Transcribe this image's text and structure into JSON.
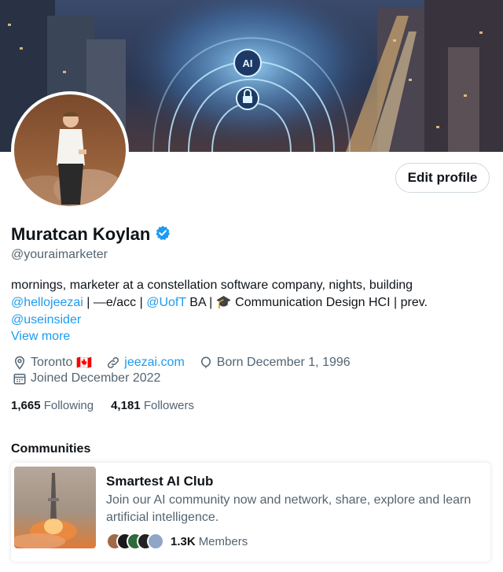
{
  "profile": {
    "name": "Muratcan Koylan",
    "handle": "@youraimarketer",
    "edit_button": "Edit profile",
    "verified_icon": "verified-badge-icon",
    "bio": {
      "line1": "mornings, marketer at a constellation software company, nights, building",
      "mention1": "@hellojeezai",
      "seg1": " | —e/acc | ",
      "mention2": "@UofT",
      "seg2": " BA | ",
      "emoji": "🎓",
      "seg3": " Communication Design HCI | prev.",
      "mention3": "@useinsider"
    },
    "view_more": "View more",
    "location": "Toronto",
    "location_flag": "🇨🇦",
    "website": "jeezai.com",
    "born": "Born December 1, 1996",
    "joined": "Joined December 2022",
    "following_count": "1,665",
    "following_label": "Following",
    "followers_count": "4,181",
    "followers_label": "Followers"
  },
  "banner": {
    "ai_text": "AI"
  },
  "communities": {
    "title": "Communities",
    "card": {
      "name": "Smartest AI Club",
      "description": "Join our AI community now and network, share, explore and learn artificial intelligence.",
      "members_count": "1.3K",
      "members_label": "Members"
    }
  },
  "colors": {
    "accent": "#1d9bf0",
    "text_primary": "#0f1419",
    "text_secondary": "#536471"
  }
}
